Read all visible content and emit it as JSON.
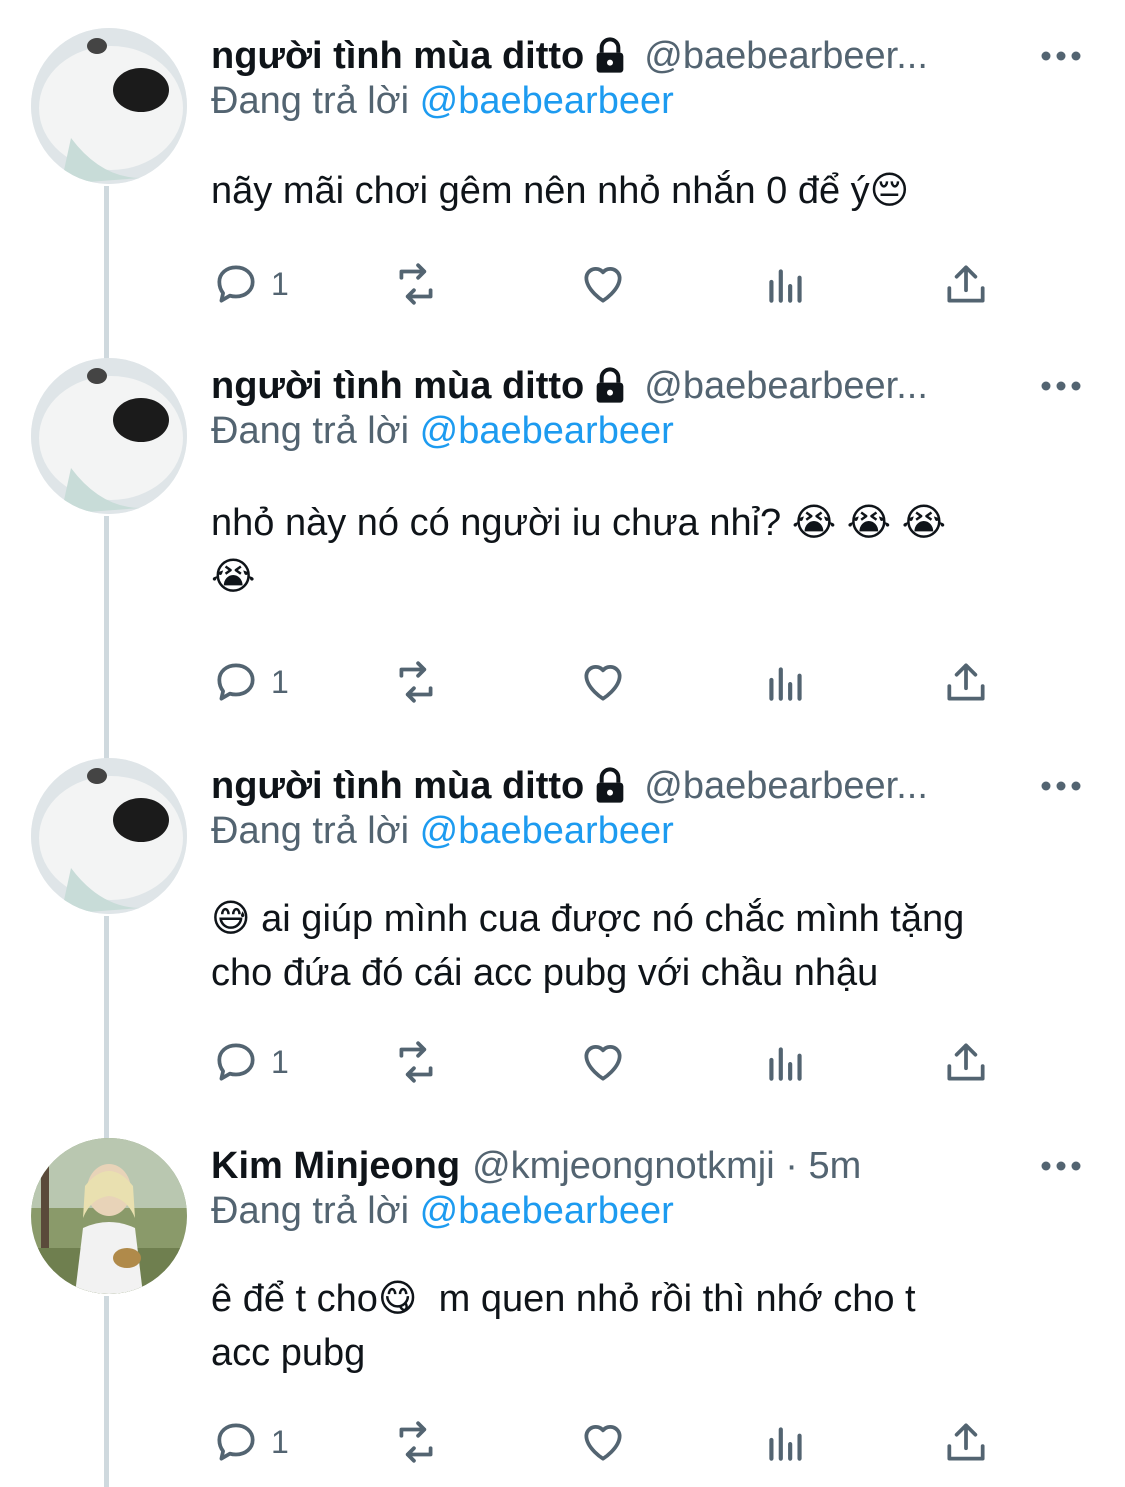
{
  "tweets": [
    {
      "name": "người tình mùa ditto",
      "handle": "@baebearbeer...",
      "reply_prefix": "Đang trả lời ",
      "reply_mention": "@baebearbeer",
      "text": "nãy mãi chơi gêm nên nhỏ nhắn 0 để ý😔",
      "reply_count": "1"
    },
    {
      "name": "người tình mùa ditto",
      "handle": "@baebearbeer...",
      "reply_prefix": "Đang trả lời ",
      "reply_mention": "@baebearbeer",
      "text": "nhỏ này nó có người iu chưa nhỉ? 😭 😭 😭\n😭",
      "reply_count": "1"
    },
    {
      "name": "người tình mùa ditto",
      "handle": "@baebearbeer...",
      "reply_prefix": "Đang trả lời ",
      "reply_mention": "@baebearbeer",
      "text": "😅 ai giúp mình cua được nó chắc mình tặng\ncho đứa đó cái acc pubg với chầu nhậu",
      "reply_count": "1"
    },
    {
      "name": "Kim Minjeong",
      "handle": "@kmjeongnotkmji · 5m",
      "reply_prefix": "Đang trả lời ",
      "reply_mention": "@baebearbeer",
      "text": "ê để t cho😋  m quen nhỏ rồi thì nhớ cho t\nacc pubg",
      "reply_count": "1"
    }
  ],
  "icons": {
    "reply": "reply-icon",
    "retweet": "retweet-icon",
    "like": "heart-icon",
    "analytics": "analytics-icon",
    "share": "share-icon",
    "more": "more-icon",
    "lock": "lock-icon"
  },
  "colors": {
    "name": "#0f1419",
    "secondary": "#536471",
    "mention": "#1d9bf0",
    "thread_line": "#cfd9de"
  }
}
